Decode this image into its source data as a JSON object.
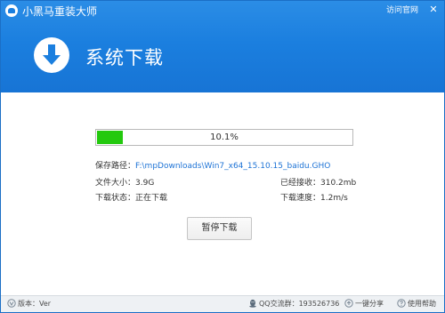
{
  "app": {
    "title": "小黑马重装大师",
    "site_link": "访问官网",
    "close_glyph": "✕"
  },
  "header": {
    "page_title": "系统下载",
    "icon": "download-arrow-icon"
  },
  "download": {
    "progress_percent": 10.1,
    "progress_label": "10.1%",
    "save_path_label": "保存路径：",
    "save_path_value": "F:\\mpDownloads\\Win7_x64_15.10.15_baidu.GHO",
    "file_size_label": "文件大小：",
    "file_size_value": "3.9G",
    "received_label": "已经接收：",
    "received_value": "310.2mb",
    "status_label": "下载状态：",
    "status_value": "正在下载",
    "speed_label": "下载速度：",
    "speed_value": "1.2m/s",
    "pause_button": "暂停下载"
  },
  "footer": {
    "version": "版本：Ver",
    "qq_group": "QQ交流群：193526736",
    "share": "一键分享",
    "help": "使用帮助"
  },
  "colors": {
    "header_blue": "#1b7fdf",
    "progress_green": "#23c90e",
    "link_blue": "#1f74d6"
  }
}
